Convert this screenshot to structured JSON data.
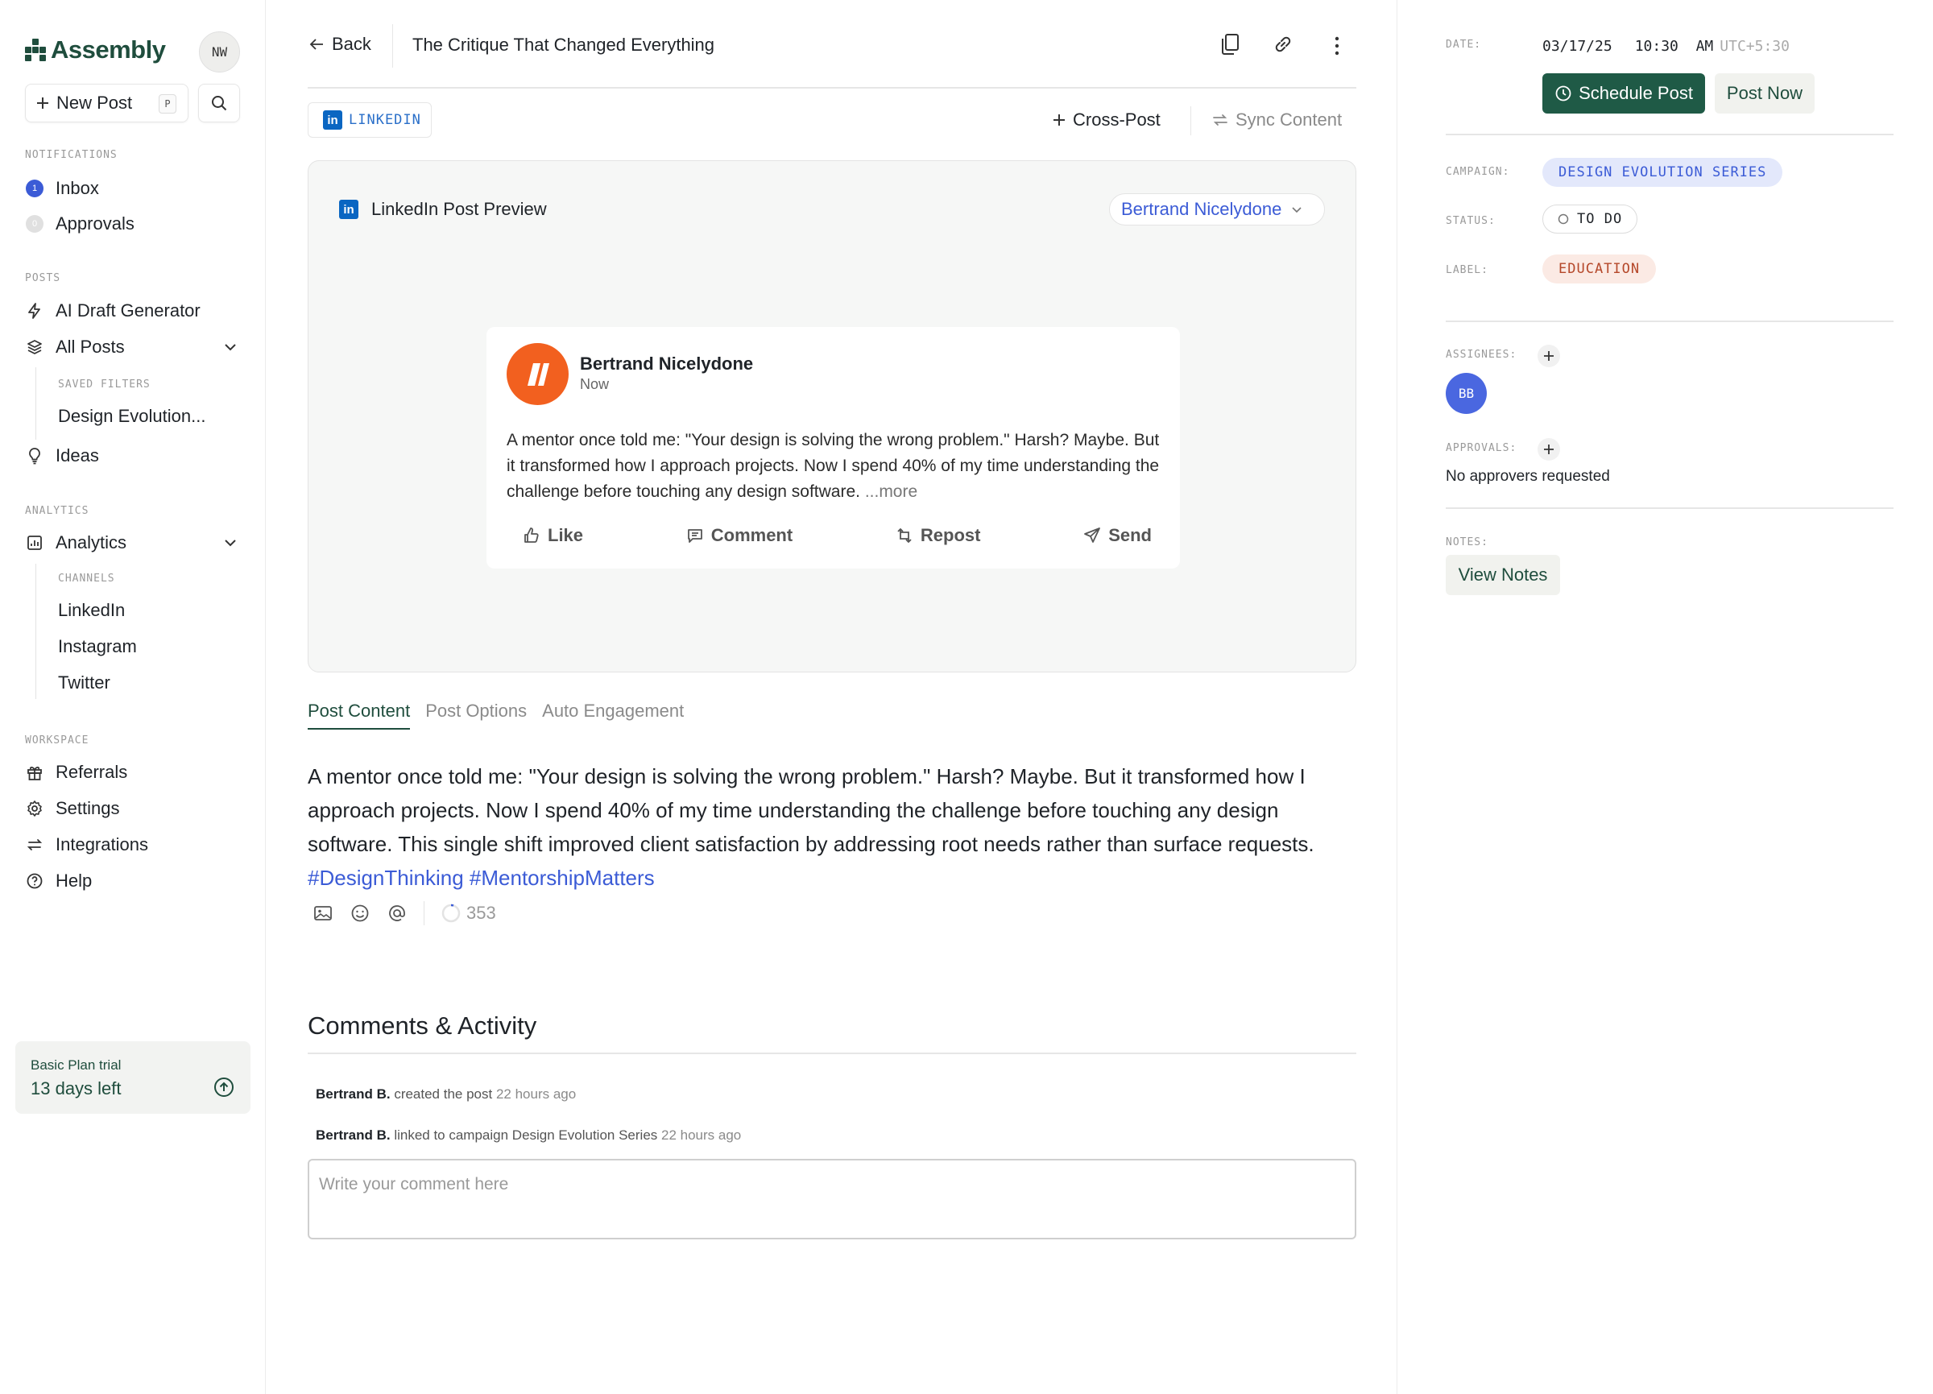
{
  "sidebar": {
    "brand": "Assembly",
    "user_initials": "NW",
    "new_post_label": "New Post",
    "new_post_shortcut": "P",
    "sections": {
      "notifications": "NOTIFICATIONS",
      "posts": "POSTS",
      "analytics": "ANALYTICS",
      "workspace": "WORKSPACE"
    },
    "inbox": {
      "label": "Inbox",
      "count": "1"
    },
    "approvals": {
      "label": "Approvals",
      "count": "0"
    },
    "ai_draft": "AI Draft Generator",
    "all_posts": "All Posts",
    "saved_filters_label": "SAVED FILTERS",
    "saved_filter_item": "Design Evolution...",
    "ideas": "Ideas",
    "analytics": "Analytics",
    "channels_label": "CHANNELS",
    "channels": [
      "LinkedIn",
      "Instagram",
      "Twitter"
    ],
    "referrals": "Referrals",
    "settings": "Settings",
    "integrations": "Integrations",
    "help": "Help",
    "plan": {
      "title": "Basic Plan trial",
      "days": "13 days left"
    }
  },
  "main": {
    "back_label": "Back",
    "title": "The Critique That Changed Everything",
    "channel_chip": "LINKEDIN",
    "cross_post": "Cross-Post",
    "sync_content": "Sync Content",
    "preview": {
      "heading": "LinkedIn Post Preview",
      "account": "Bertrand Nicelydone",
      "author": "Bertrand Nicelydone",
      "time": "Now",
      "text": "A mentor once told me: \"Your design is solving the wrong problem.\" Harsh? Maybe. But it transformed how I approach projects. Now I spend 40% of my time understanding the challenge before touching any design software.",
      "more": "...more",
      "actions": {
        "like": "Like",
        "comment": "Comment",
        "repost": "Repost",
        "send": "Send"
      }
    },
    "tabs": [
      "Post Content",
      "Post Options",
      "Auto Engagement"
    ],
    "content_text": "A mentor once told me: \"Your design is solving the wrong problem.\" Harsh? Maybe. But it transformed how I approach projects. Now I spend 40% of my time understanding the challenge before touching any design software. This single shift improved client satisfaction by addressing root needs rather than surface requests.",
    "hashtags": [
      "#DesignThinking",
      "#MentorshipMatters"
    ],
    "char_count": "353",
    "comments_title": "Comments & Activity",
    "activity": [
      {
        "user": "Bertrand B.",
        "action": "created the post",
        "ago": "22 hours ago"
      },
      {
        "user": "Bertrand B.",
        "action": "linked to campaign Design Evolution Series",
        "ago": "22 hours ago"
      }
    ],
    "comment_placeholder": "Write your comment here"
  },
  "right": {
    "date_label": "DATE:",
    "date": "03/17/25",
    "time": "10:30",
    "meridiem": "AM",
    "tz": "UTC+5:30",
    "schedule_label": "Schedule Post",
    "post_now_label": "Post Now",
    "campaign_label": "CAMPAIGN:",
    "campaign": "DESIGN EVOLUTION SERIES",
    "status_label": "STATUS:",
    "status": "TO DO",
    "label_label": "LABEL:",
    "label": "EDUCATION",
    "assignees_label": "ASSIGNEES:",
    "assignee_initials": "BB",
    "approvals_label": "APPROVALS:",
    "no_approvers": "No approvers requested",
    "notes_label": "NOTES:",
    "view_notes": "View Notes"
  },
  "colors": {
    "brand_green": "#1f5a46",
    "link_blue": "#3b5bd6",
    "linkedin_blue": "#0a66c2",
    "avatar_orange": "#f2601f"
  },
  "icons": [
    "logo-icon",
    "plus-icon",
    "search-icon",
    "bolt-icon",
    "layers-icon",
    "bulb-icon",
    "chart-icon",
    "gift-icon",
    "gear-icon",
    "arrows-icon",
    "help-icon",
    "arrow-up-circle-icon",
    "arrow-left-icon",
    "copy-icon",
    "link-icon",
    "more-vertical-icon",
    "sync-icon",
    "chevron-down-icon",
    "like-icon",
    "comment-icon",
    "repost-icon",
    "send-icon",
    "image-icon",
    "emoji-icon",
    "at-icon",
    "progress-ring-icon",
    "clock-icon"
  ]
}
